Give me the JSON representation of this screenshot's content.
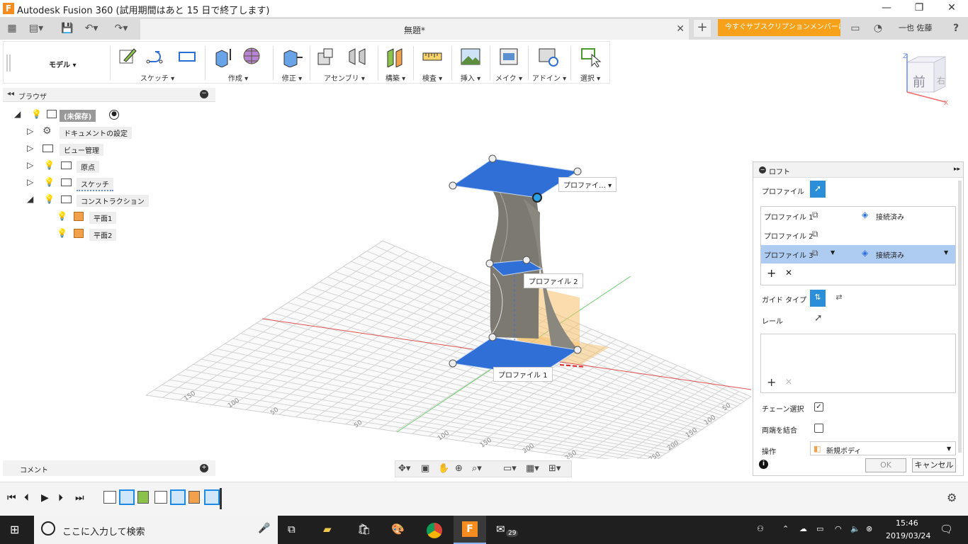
{
  "window": {
    "title": "Autodesk Fusion 360 (試用期間はあと 15 日で終了します)",
    "logo_letter": "F",
    "minimize": "—",
    "maximize": "❐",
    "close": "✕"
  },
  "tabbar": {
    "doc_tab": "無題*",
    "doc_tab_close": "✕",
    "new_tab": "+",
    "subscription_button": "今すぐサブスクリプションメンバーに…",
    "user_name": "一也 佐藤",
    "help": "?"
  },
  "toolbar": {
    "workspace": "モデル ▾",
    "groups": [
      {
        "label": "スケッチ ▾"
      },
      {
        "label": "作成 ▾"
      },
      {
        "label": "修正 ▾"
      },
      {
        "label": "アセンブリ ▾"
      },
      {
        "label": "構築 ▾"
      },
      {
        "label": "検査 ▾"
      },
      {
        "label": "挿入 ▾"
      },
      {
        "label": "メイク ▾"
      },
      {
        "label": "アドイン ▾"
      },
      {
        "label": "選択 ▾"
      }
    ]
  },
  "browser": {
    "title": "ブラウザ",
    "items": [
      {
        "label": "(未保存)"
      },
      {
        "label": "ドキュメントの設定"
      },
      {
        "label": "ビュー管理"
      },
      {
        "label": "原点"
      },
      {
        "label": "スケッチ"
      },
      {
        "label": "コンストラクション"
      },
      {
        "label": "平面1"
      },
      {
        "label": "平面2"
      }
    ]
  },
  "comment_panel": {
    "title": "コメント"
  },
  "viewport": {
    "profile_labels": [
      "プロファイ… ▾",
      "プロファイル 2",
      "プロファイル 1"
    ],
    "viewcube": {
      "face": "前",
      "side": "右",
      "axis_z": "Z",
      "axis_x": "X"
    },
    "grid_ticks": [
      "150",
      "100",
      "50",
      "50",
      "100",
      "150",
      "200",
      "250",
      "50",
      "100",
      "150",
      "200",
      "250"
    ]
  },
  "loft": {
    "title": "ロフト",
    "profile_label": "プロファイル",
    "profiles": [
      {
        "name": "プロファイル 1",
        "status": "接続済み"
      },
      {
        "name": "プロファイル 2",
        "status": ""
      },
      {
        "name": "プロファイル 3",
        "status": "接続済み"
      }
    ],
    "add": "+",
    "remove": "✕",
    "guide_type": "ガイド タイプ",
    "rail": "レール",
    "chain_select": "チェーン選択",
    "chain_select_checked": true,
    "join_ends": "両端を結合",
    "join_ends_checked": false,
    "operation": "操作",
    "operation_value": "新規ボディ",
    "ok": "OK",
    "cancel": "キャンセル",
    "info": "i"
  },
  "taskbar": {
    "search_placeholder": "ここに入力して検索",
    "time": "15:46",
    "date": "2019/03/24",
    "mail_badge": "29"
  },
  "colors": {
    "accent_orange": "#f7a11a",
    "selection_blue": "#2f6fd6",
    "surface_gray": "#7c7a70"
  }
}
